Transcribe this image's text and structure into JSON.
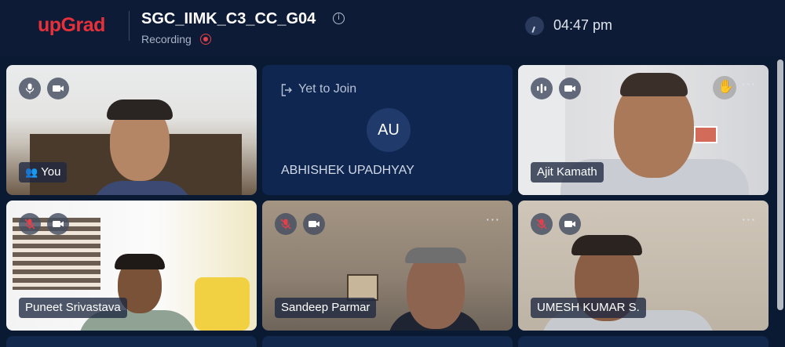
{
  "header": {
    "logo": "upGrad",
    "meeting_title": "SGC_IIMK_C3_CC_G04",
    "recording_label": "Recording",
    "time": "04:47 pm"
  },
  "tiles": [
    {
      "name": "You",
      "status": "video"
    },
    {
      "name": "ABHISHEK UPADHYAY",
      "status": "Yet to Join",
      "initials": "AU"
    },
    {
      "name": "Ajit Kamath",
      "status": "video"
    },
    {
      "name": "Puneet Srivastava",
      "status": "video"
    },
    {
      "name": "Sandeep Parmar",
      "status": "video"
    },
    {
      "name": "UMESH KUMAR S.",
      "status": "video"
    }
  ],
  "more_label": "···",
  "colors": {
    "brand": "#e7313a",
    "background": "#0b1a33",
    "muted_mic": "#e2404a"
  }
}
